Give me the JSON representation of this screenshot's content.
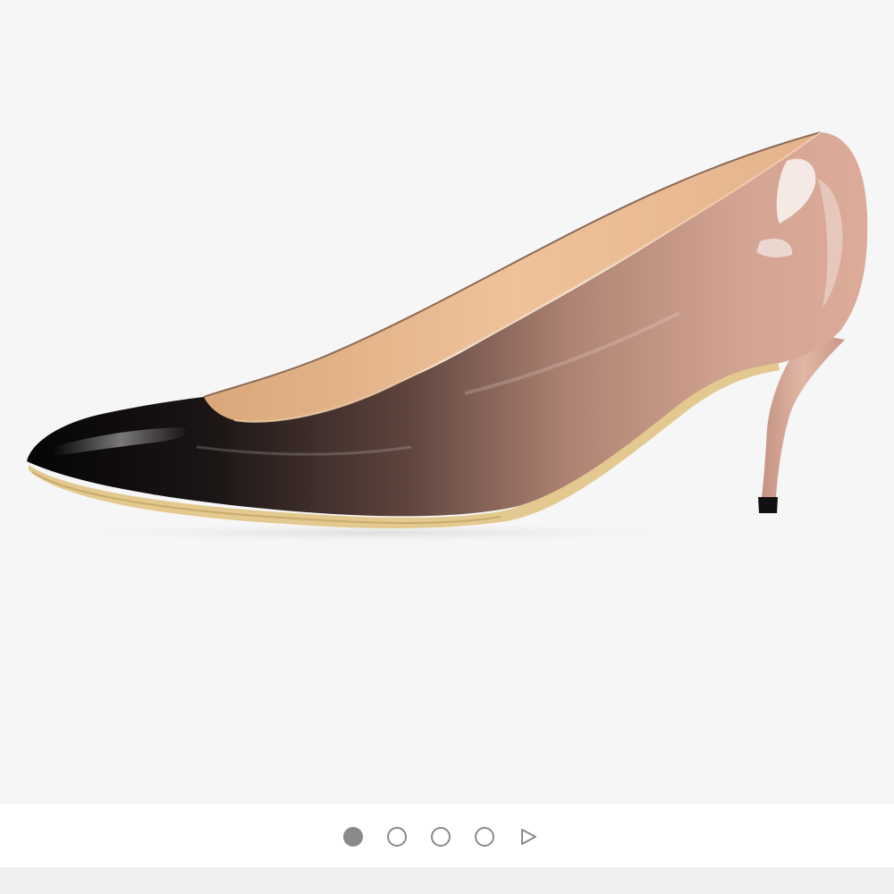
{
  "viewer": {
    "background": "#f6f6f6",
    "product_image": {
      "subject": "shoe-image",
      "colors": {
        "toe": "#0c0a0b",
        "mid": "#6e5048",
        "heel": "#d9a896",
        "lining": "#e9b88e",
        "sole": "#e6cf95"
      }
    },
    "pagination": {
      "total_images": 4,
      "current_index": 1,
      "dot_color": "#8a8a8a",
      "play_icon": "play-icon"
    }
  }
}
